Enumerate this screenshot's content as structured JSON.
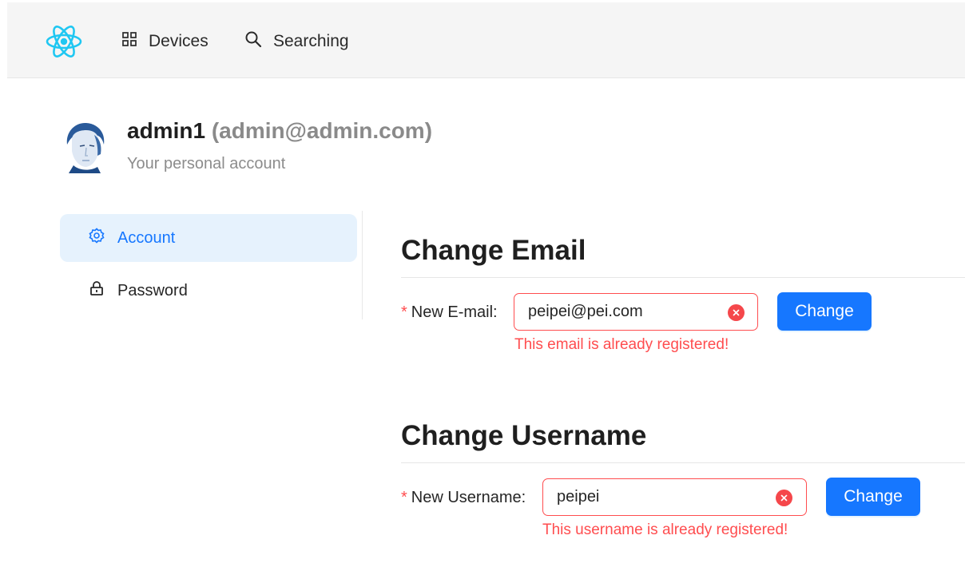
{
  "header": {
    "nav": [
      {
        "label": "Devices",
        "icon": "grid-icon"
      },
      {
        "label": "Searching",
        "icon": "search-icon"
      }
    ],
    "logo_color": "#1fc7f2"
  },
  "profile": {
    "username": "admin1",
    "email": "(admin@admin.com)",
    "subtitle": "Your personal account"
  },
  "sidebar": {
    "items": [
      {
        "label": "Account",
        "icon": "gear-icon",
        "active": true
      },
      {
        "label": "Password",
        "icon": "lock-icon",
        "active": false
      }
    ]
  },
  "email_section": {
    "title": "Change Email",
    "required_mark": "*",
    "label": "New E-mail",
    "colon": ":",
    "value": "peipei@pei.com",
    "button": "Change",
    "error": "This email is already registered!"
  },
  "username_section": {
    "title": "Change Username",
    "required_mark": "*",
    "label": "New Username",
    "colon": ":",
    "value": "peipei",
    "button": "Change",
    "error": "This username is already registered!"
  },
  "colors": {
    "primary": "#1677ff",
    "error": "#ff4d4f",
    "active_bg": "#e6f2fd"
  }
}
